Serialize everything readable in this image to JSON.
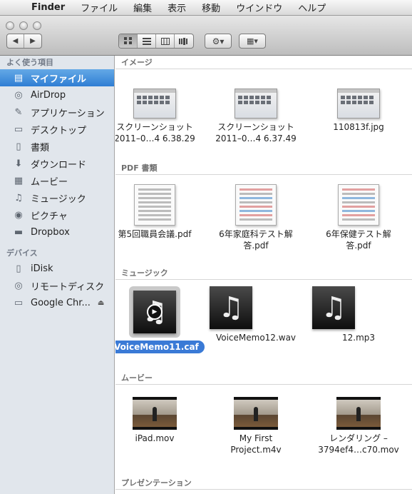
{
  "menubar": {
    "apple": "",
    "app": "Finder",
    "items": [
      "ファイル",
      "編集",
      "表示",
      "移動",
      "ウインドウ",
      "ヘルプ"
    ]
  },
  "toolbar": {
    "back_icon": "◀",
    "forward_icon": "▶",
    "view_icons": [
      "icon-view",
      "list-view",
      "column-view",
      "coverflow-view"
    ],
    "gear_icon": "⚙▾",
    "arrange_icon": "▦▾"
  },
  "sidebar": {
    "favorites_header": "よく使う項目",
    "favorites": [
      {
        "label": "マイファイル",
        "icon": "allmyfiles-icon",
        "glyph": "▤"
      },
      {
        "label": "AirDrop",
        "icon": "airdrop-icon",
        "glyph": "◎"
      },
      {
        "label": "アプリケーション",
        "icon": "applications-icon",
        "glyph": "✎"
      },
      {
        "label": "デスクトップ",
        "icon": "desktop-icon",
        "glyph": "▭"
      },
      {
        "label": "書類",
        "icon": "documents-icon",
        "glyph": "▯"
      },
      {
        "label": "ダウンロード",
        "icon": "downloads-icon",
        "glyph": "⬇"
      },
      {
        "label": "ムービー",
        "icon": "movies-icon",
        "glyph": "▦"
      },
      {
        "label": "ミュージック",
        "icon": "music-icon",
        "glyph": "♫"
      },
      {
        "label": "ピクチャ",
        "icon": "pictures-icon",
        "glyph": "◉"
      },
      {
        "label": "Dropbox",
        "icon": "folder-icon",
        "glyph": "▬"
      }
    ],
    "devices_header": "デバイス",
    "devices": [
      {
        "label": "iDisk",
        "icon": "idisk-icon",
        "glyph": "▯"
      },
      {
        "label": "リモートディスク",
        "icon": "remote-disc-icon",
        "glyph": "◎"
      },
      {
        "label": "Google Chr...",
        "icon": "disk-image-icon",
        "glyph": "▭",
        "eject": "⏏"
      }
    ]
  },
  "sections": [
    {
      "header": "イメージ",
      "items": [
        {
          "label": "スクリーンショット",
          "label2": "2011–0…4 6.38.29",
          "kind": "screenshot"
        },
        {
          "label": "スクリーンショット",
          "label2": "2011–0…4 6.37.49",
          "kind": "screenshot"
        },
        {
          "label": "110813f.jpg",
          "label2": "",
          "kind": "image"
        }
      ]
    },
    {
      "header": "PDF 書類",
      "items": [
        {
          "label": "第5回職員会議.pdf",
          "label2": "",
          "kind": "pdf"
        },
        {
          "label": "6年家庭科テスト解",
          "label2": "答.pdf",
          "kind": "pdf-color"
        },
        {
          "label": "6年保健テスト解",
          "label2": "答.pdf",
          "kind": "pdf-color"
        }
      ]
    },
    {
      "header": "ミュージック",
      "items": [
        {
          "label": "VoiceMemo11.caf",
          "label2": "",
          "kind": "audio",
          "selected": true
        },
        {
          "label": "VoiceMemo12.wav",
          "label2": "",
          "kind": "audio"
        },
        {
          "label": "12.mp3",
          "label2": "",
          "kind": "audio"
        }
      ]
    },
    {
      "header": "ムービー",
      "items": [
        {
          "label": "iPad.mov",
          "label2": "",
          "kind": "movie"
        },
        {
          "label": "My First",
          "label2": "Project.m4v",
          "kind": "movie"
        },
        {
          "label": "レンダリング –",
          "label2": "3794ef4…c70.mov",
          "kind": "movie"
        }
      ]
    },
    {
      "header": "プレゼンテーション",
      "items": []
    }
  ]
}
